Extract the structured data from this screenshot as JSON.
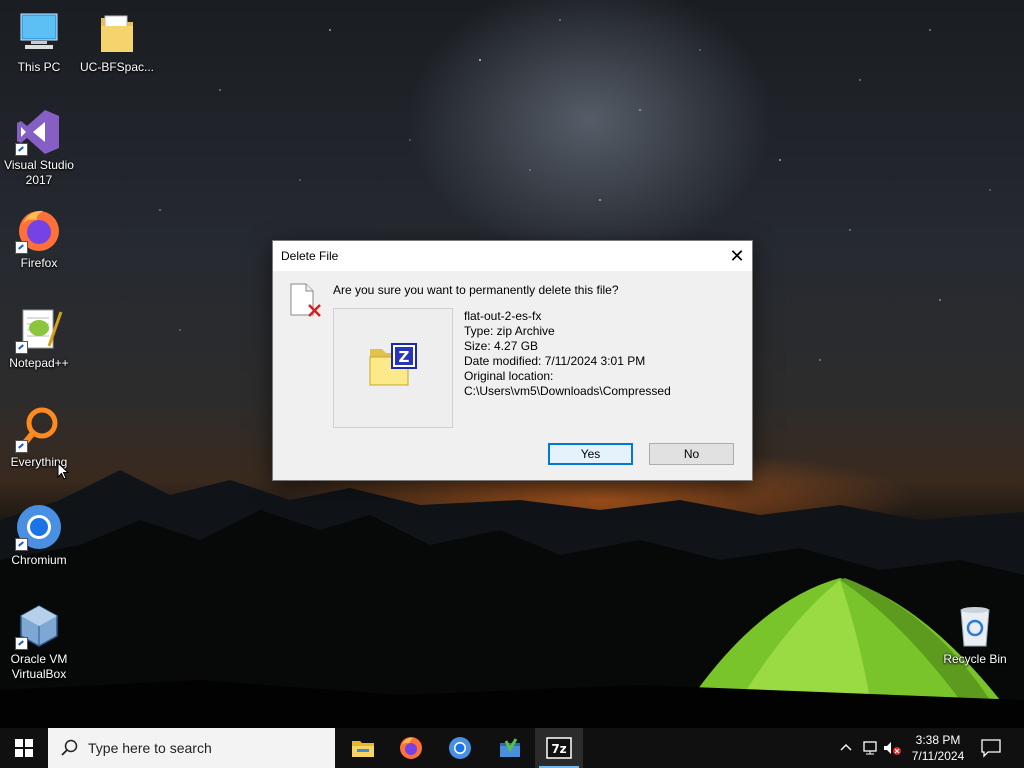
{
  "desktop": {
    "icons": [
      {
        "label": "This PC"
      },
      {
        "label": "UC-BFSpac..."
      },
      {
        "label": "Visual Studio 2017"
      },
      {
        "label": "Firefox"
      },
      {
        "label": "Notepad++"
      },
      {
        "label": "Everything"
      },
      {
        "label": "Chromium"
      },
      {
        "label": "Oracle VM VirtualBox"
      },
      {
        "label": "Recycle Bin"
      }
    ]
  },
  "dialog": {
    "title": "Delete File",
    "close_glyph": "✕",
    "question": "Are you sure you want to permanently delete this file?",
    "file": {
      "name": "flat-out-2-es-fx",
      "type": "Type: zip Archive",
      "size": "Size: 4.27 GB",
      "modified": "Date modified: 7/11/2024 3:01 PM",
      "location_label": "Original location:",
      "location": "C:\\Users\\vm5\\Downloads\\Compressed"
    },
    "buttons": {
      "yes": "Yes",
      "no": "No"
    }
  },
  "taskbar": {
    "search_placeholder": "Type here to search",
    "apps": [
      "file-explorer",
      "firefox",
      "chromium",
      "app-green",
      "7zip"
    ],
    "app_7zip_label": "7z",
    "clock": {
      "time": "3:38 PM",
      "date": "7/11/2024"
    }
  },
  "colors": {
    "accent": "#0078d7",
    "taskbar": "#101010",
    "dialog_bg": "#f0f0f0"
  }
}
